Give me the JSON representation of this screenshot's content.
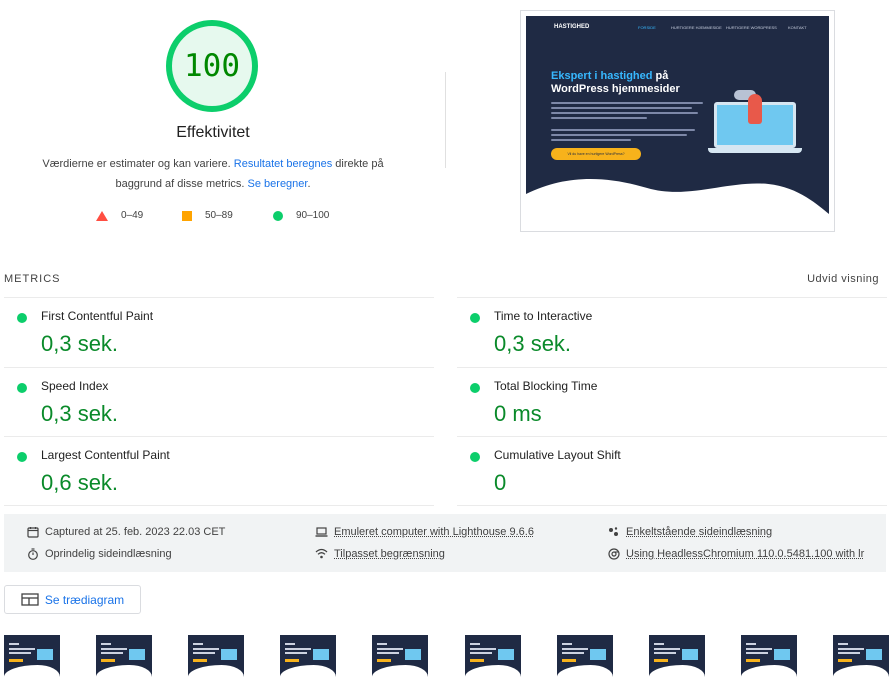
{
  "score": {
    "value": "100",
    "title": "Effektivitet",
    "desc_prefix": "Værdierne er estimater og kan variere. ",
    "desc_link1": "Resultatet beregnes",
    "desc_middle": " direkte på baggrund af disse metrics. ",
    "desc_link2": "Se beregner",
    "desc_suffix": ".",
    "legend": [
      {
        "shape": "triangle",
        "label": "0–49",
        "color": "#ff4e42"
      },
      {
        "shape": "square",
        "label": "50–89",
        "color": "#ffa400"
      },
      {
        "shape": "circle",
        "label": "90–100",
        "color": "#0cce6b"
      }
    ]
  },
  "screenshot": {
    "logo": "HASTIGHED",
    "nav": [
      "FORSIDE",
      "HURTIGERE HJEMMESIDE",
      "HURTIGERE WORDPRESS",
      "KONTAKT"
    ],
    "heading_highlight": "Ekspert i hastighed",
    "heading_rest": " på WordPress hjemmesider",
    "button": "Vil du have en hurtigere WordPress?"
  },
  "metrics": {
    "heading": "METRICS",
    "expand_label": "Udvid visning",
    "items": [
      {
        "label": "First Contentful Paint",
        "value": "0,3 sek."
      },
      {
        "label": "Time to Interactive",
        "value": "0,3 sek."
      },
      {
        "label": "Speed Index",
        "value": "0,3 sek."
      },
      {
        "label": "Total Blocking Time",
        "value": "0 ms"
      },
      {
        "label": "Largest Contentful Paint",
        "value": "0,6 sek."
      },
      {
        "label": "Cumulative Layout Shift",
        "value": "0"
      }
    ],
    "status_color": "#0cce6b"
  },
  "info": {
    "captured": "Captured at 25. feb. 2023 22.03 CET",
    "initial_load": "Oprindelig sideindlæsning",
    "emulated": "Emuleret computer with Lighthouse 9.6.6",
    "throttling": "Tilpasset begrænsning",
    "single_load": "Enkeltstående sideindlæsning",
    "browser": "Using HeadlessChromium 110.0.5481.100 with lr"
  },
  "treemap": {
    "label": "Se trædiagram"
  },
  "filmstrip": {
    "frame_count": 10
  },
  "colors": {
    "pass": "#0cce6b",
    "pass_text": "#0a8a2a",
    "link": "#1a73e8",
    "average": "#ffa400",
    "fail": "#ff4e42"
  }
}
